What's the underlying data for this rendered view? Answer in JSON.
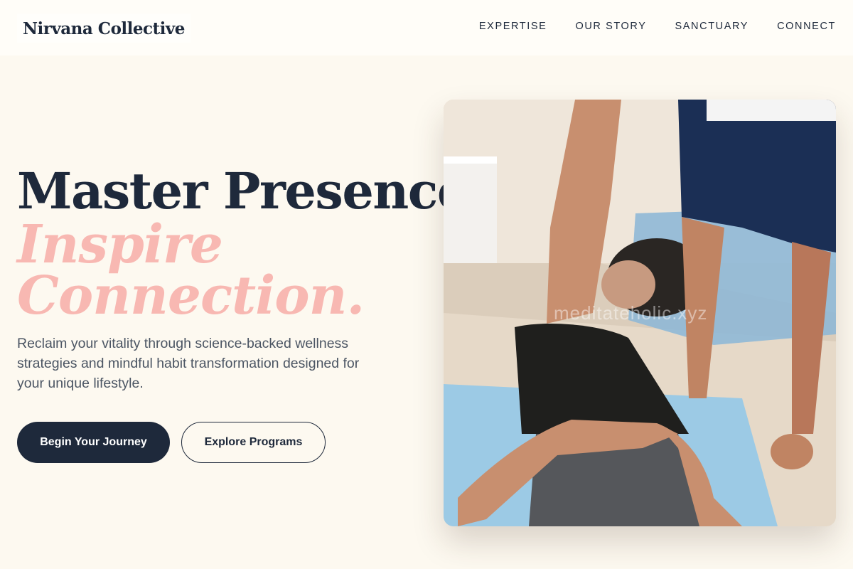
{
  "brand": {
    "name": "Nirvana Collective"
  },
  "nav": {
    "items": [
      "EXPERTISE",
      "OUR STORY",
      "SANCTUARY",
      "CONNECT"
    ]
  },
  "hero": {
    "title_line1": "Master Presence,",
    "title_line2": "Inspire",
    "title_line3": "Connection.",
    "subtitle": "Reclaim your vitality through science-backed wellness strategies and mindful habit transformation designed for your unique lifestyle.",
    "primary_button": "Begin Your Journey",
    "secondary_button": "Explore Programs",
    "image_watermark": "meditateholic.xyz",
    "accent_color": "#f8b8b2",
    "dark_color": "#1e293b"
  }
}
